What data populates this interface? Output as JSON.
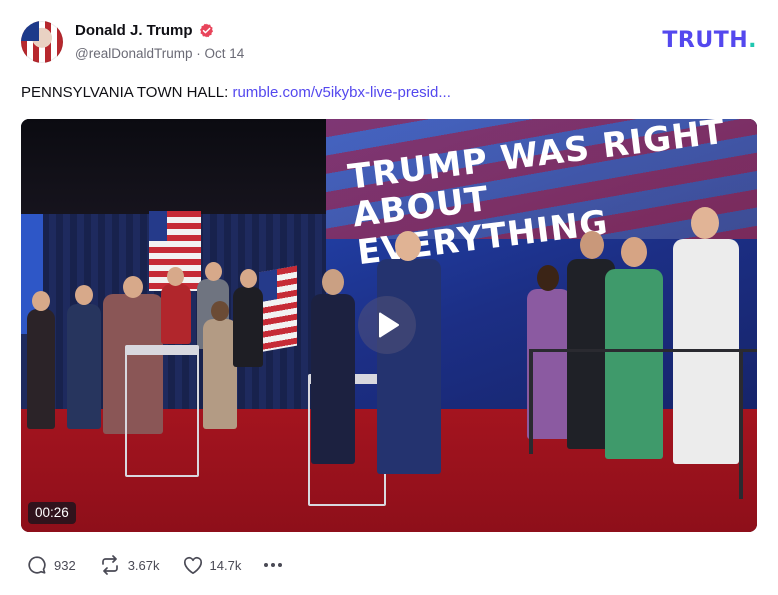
{
  "author": {
    "display_name": "Donald J. Trump",
    "handle": "@realDonaldTrump",
    "separator": "·",
    "date": "Oct 14",
    "avatar_icon": "avatar-photo",
    "verified_icon": "verified-badge-icon",
    "verified_color": "#e8445a"
  },
  "brand": {
    "logo_text": "TRUTH",
    "logo_dot": ".",
    "logo_color": "#5448ee",
    "dot_color": "#20c7b0"
  },
  "post": {
    "text_prefix": "PENNSYLVANIA TOWN HALL: ",
    "link_text": "rumble.com/v5ikybx-live-presid...",
    "link_color": "#5448ee"
  },
  "media": {
    "type": "video",
    "banner_headline": "TRUMP WAS RIGHT ABOUT EVERYTHING",
    "duration": "00:26",
    "play_icon": "play-icon"
  },
  "actions": {
    "replies": {
      "icon": "reply-icon",
      "count": "932"
    },
    "retruths": {
      "icon": "retruth-icon",
      "count": "3.67k"
    },
    "likes": {
      "icon": "heart-icon",
      "count": "14.7k"
    },
    "more": {
      "icon": "more-icon"
    }
  }
}
